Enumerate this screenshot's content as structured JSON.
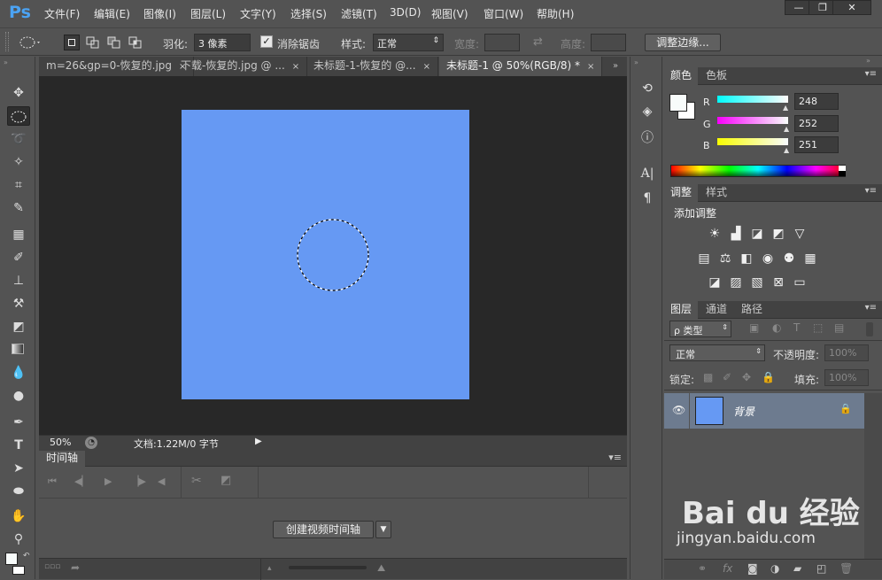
{
  "app": {
    "logo": "Ps"
  },
  "menu": [
    "文件(F)",
    "编辑(E)",
    "图像(I)",
    "图层(L)",
    "文字(Y)",
    "选择(S)",
    "滤镜(T)",
    "3D(D)",
    "视图(V)",
    "窗口(W)",
    "帮助(H)"
  ],
  "window_controls": {
    "minimize": "—",
    "restore": "❐",
    "close": "✕"
  },
  "options": {
    "feather_label": "羽化:",
    "feather_value": "3 像素",
    "antialias_label": "消除锯齿",
    "antialias_checked": true,
    "style_label": "样式:",
    "style_value": "正常",
    "width_label": "宽度:",
    "height_label": "高度:",
    "refine_button": "调整边缘..."
  },
  "doc_tabs": [
    {
      "label": "m=26&gp=0-恢复的.jpg",
      "close": "×"
    },
    {
      "label": "下载-恢复的.jpg @ ...",
      "close": "×"
    },
    {
      "label": "未标题-1-恢复的 @...",
      "close": "×"
    },
    {
      "label": "未标题-1 @ 50%(RGB/8) *",
      "close": "×"
    }
  ],
  "canvas": {
    "fill_color": "#6699f3"
  },
  "status": {
    "zoom": "50%",
    "doc_info": "文档:1.22M/0 字节"
  },
  "timeline": {
    "panel_title": "时间轴",
    "create_button": "创建视频时间轴"
  },
  "color_panel": {
    "tabs": [
      "颜色",
      "色板"
    ],
    "r_label": "R",
    "g_label": "G",
    "b_label": "B",
    "r": "248",
    "g": "252",
    "b": "251",
    "fg_color": "#f8fcfb",
    "bg_color": "#ffffff"
  },
  "adjust_panel": {
    "tabs": [
      "调整",
      "样式"
    ],
    "title": "添加调整"
  },
  "layers_panel": {
    "tabs": [
      "图层",
      "通道",
      "路径"
    ],
    "filter_label": "ρ 类型",
    "blend_mode": "正常",
    "opacity_label": "不透明度:",
    "opacity_value": "100%",
    "lock_label": "锁定:",
    "fill_label": "填充:",
    "fill_value": "100%",
    "layer_name": "背景"
  },
  "watermark": {
    "brand": "Bai du 经验",
    "url": "jingyan.baidu.com"
  }
}
